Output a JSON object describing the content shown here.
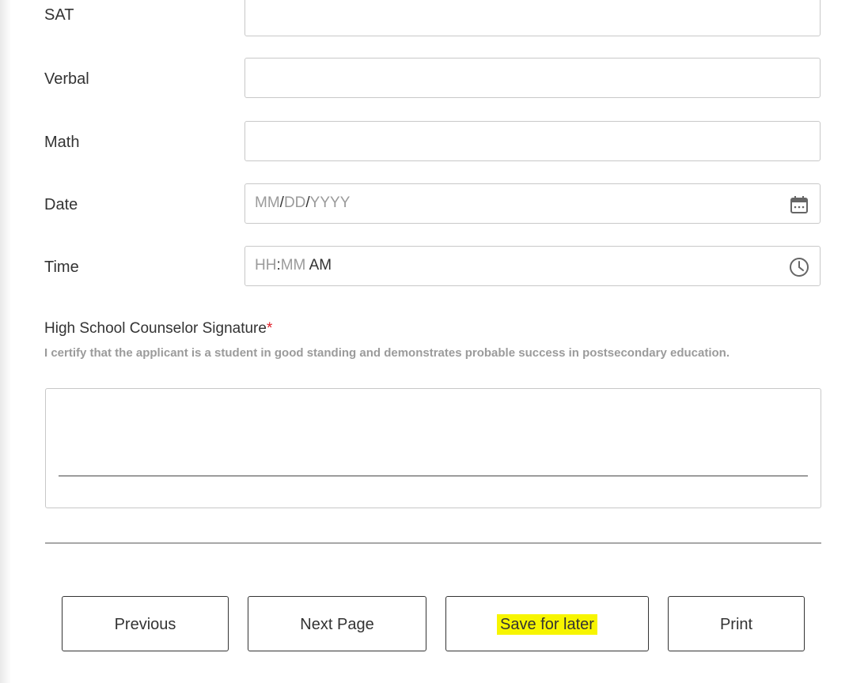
{
  "form": {
    "fields": [
      {
        "label": "SAT",
        "value": ""
      },
      {
        "label": "Verbal",
        "value": ""
      },
      {
        "label": "Math",
        "value": ""
      }
    ],
    "date": {
      "label": "Date",
      "mm": "MM",
      "dd": "DD",
      "yyyy": "YYYY",
      "sep": "/",
      "icon": "calendar-icon"
    },
    "time": {
      "label": "Time",
      "hh": "HH",
      "sep": ":",
      "mm": "MM",
      "ampm": "AM",
      "icon": "clock-icon"
    },
    "signature": {
      "title": "High School Counselor Signature",
      "required_mark": "*",
      "help": "I certify that the applicant is a student in good standing and demonstrates probable success in postsecondary education."
    }
  },
  "buttons": {
    "previous": "Previous",
    "next": "Next Page",
    "save": "Save for later",
    "print": "Print"
  },
  "colors": {
    "required": "#e0202a",
    "highlight": "#f7f500",
    "placeholder": "#9a9a9a"
  }
}
